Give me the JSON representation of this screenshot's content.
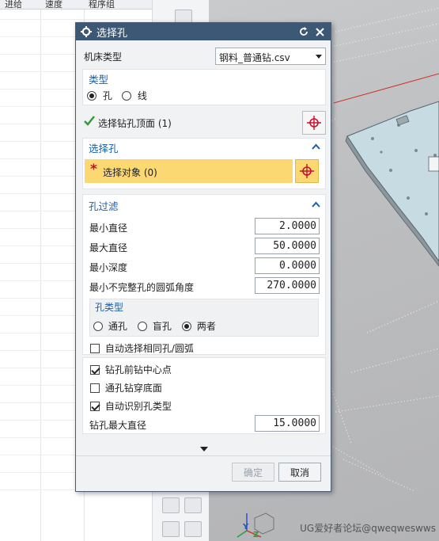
{
  "background": {
    "table_headers": [
      "进给",
      "速度",
      "程序组"
    ],
    "watermark": "UG爱好者论坛@qweqweswws"
  },
  "dialog": {
    "title": "选择孔",
    "machine_type": {
      "label": "机床类型",
      "value": "钢料_普通钻.csv"
    },
    "type": {
      "title": "类型",
      "options": [
        "孔",
        "线"
      ],
      "selected": "孔"
    },
    "drill_top": {
      "label": "选择钻孔顶面 (1)"
    },
    "select_hole": {
      "title": "选择孔",
      "select_object": "选择对象 (0)"
    },
    "hole_filter": {
      "title": "孔过滤",
      "min_diameter": {
        "label": "最小直径",
        "value": "2.0000"
      },
      "max_diameter": {
        "label": "最大直径",
        "value": "50.0000"
      },
      "min_depth": {
        "label": "最小深度",
        "value": "0.0000"
      },
      "min_arc_angle": {
        "label": "最小不完整孔的圆弧角度",
        "value": "270.0000"
      },
      "hole_type": {
        "title": "孔类型",
        "options": [
          "通孔",
          "盲孔",
          "两者"
        ],
        "selected": "两者"
      },
      "auto_select_same": {
        "label": "自动选择相同孔/圆弧",
        "checked": false
      }
    },
    "options": {
      "drill_center": {
        "label": "钻孔前钻中心点",
        "checked": true
      },
      "through_bottom": {
        "label": "通孔钻穿底面",
        "checked": false
      },
      "auto_identify": {
        "label": "自动识别孔类型",
        "checked": true
      },
      "max_drill_diameter": {
        "label": "钻孔最大直径",
        "value": "15.0000"
      }
    },
    "buttons": {
      "ok": "确定",
      "cancel": "取消"
    }
  },
  "colors": {
    "titlebar": "#3d5875",
    "section_title": "#1a5fa8",
    "required_highlight": "#fbd872",
    "target_icon": "#c8102e",
    "check_green": "#2e9e3a"
  }
}
